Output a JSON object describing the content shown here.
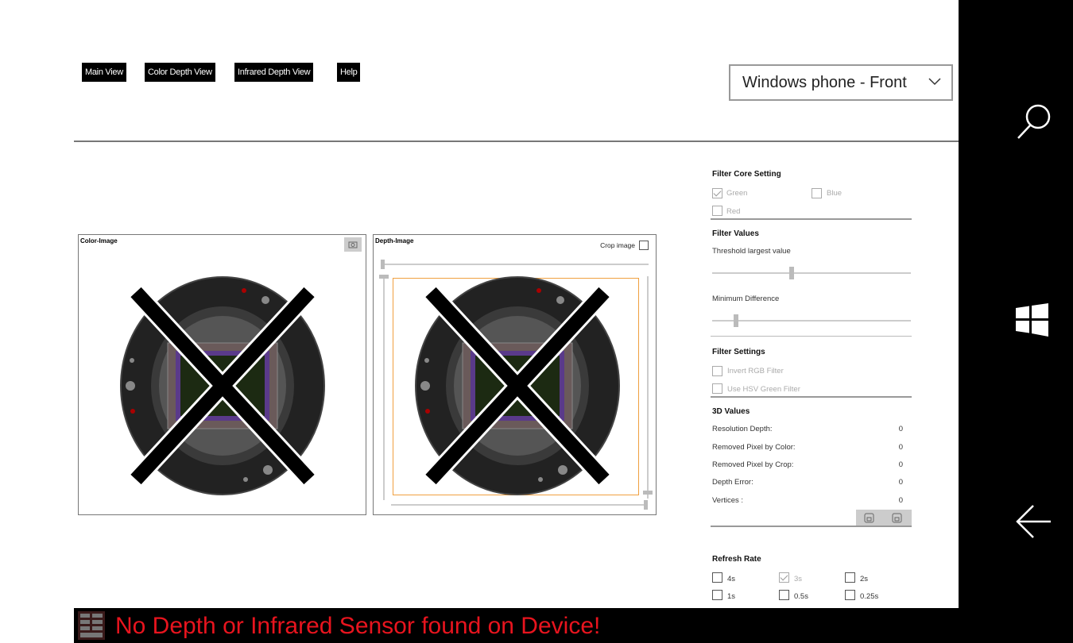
{
  "nav": {
    "main_view": "Main View",
    "color_depth_view": "Color Depth View",
    "infrared_depth_view": "Infrared Depth View",
    "help": "Help"
  },
  "camera": {
    "selected": "Windows phone - Front"
  },
  "color_panel": {
    "title": "Color-Image"
  },
  "depth_panel": {
    "title": "Depth-Image",
    "crop_label": "Crop image"
  },
  "filter_core": {
    "title": "Filter Core Setting",
    "green": "Green",
    "green_checked": true,
    "blue": "Blue",
    "blue_checked": false,
    "red": "Red",
    "red_checked": false
  },
  "filter_values": {
    "title": "Filter Values",
    "threshold_label": "Threshold largest value",
    "threshold_level": 0.4,
    "min_diff_label": "Minimum Difference",
    "min_diff_level": 0.12
  },
  "filter_settings": {
    "title": "Filter Settings",
    "invert_rgb": "Invert RGB Filter",
    "use_hsv": "Use HSV Green Filter"
  },
  "values_3d": {
    "title": "3D Values",
    "rows": [
      {
        "label": "Resolution Depth:",
        "value": "0"
      },
      {
        "label": "Removed Pixel by Color:",
        "value": "0"
      },
      {
        "label": "Removed Pixel by Crop:",
        "value": "0"
      },
      {
        "label": "Depth Error:",
        "value": "0"
      },
      {
        "label": "Vertices :",
        "value": "0"
      }
    ]
  },
  "refresh": {
    "title": "Refresh Rate",
    "options": [
      {
        "label": "4s",
        "checked": false
      },
      {
        "label": "3s",
        "checked": true
      },
      {
        "label": "2s",
        "checked": false
      },
      {
        "label": "1s",
        "checked": false
      },
      {
        "label": "0.5s",
        "checked": false
      },
      {
        "label": "0.25s",
        "checked": false
      }
    ]
  },
  "status": {
    "message": "No Depth or Infrared Sensor found on Device!"
  },
  "system_nav": {
    "icons": [
      "search-icon",
      "windows-start-icon",
      "back-arrow-icon"
    ]
  },
  "colors": {
    "status_text": "#e8141e",
    "nav_bg": "#000000",
    "selection_orange": "#f0a040"
  }
}
